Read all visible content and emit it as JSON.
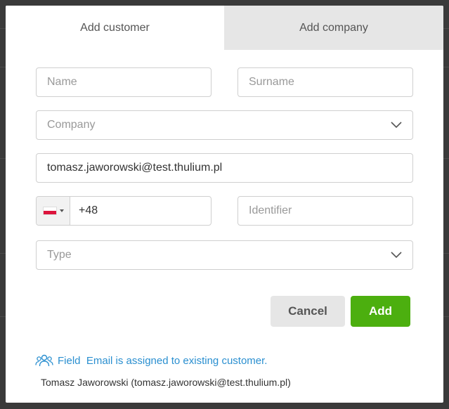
{
  "tabs": [
    {
      "label": "Add customer",
      "active": true
    },
    {
      "label": "Add company",
      "active": false
    }
  ],
  "form": {
    "name_placeholder": "Name",
    "surname_placeholder": "Surname",
    "company_placeholder": "Company",
    "email_value": "tomasz.jaworowski@test.thulium.pl",
    "phone_country_icon": "poland-flag-icon",
    "phone_value": "+48",
    "identifier_placeholder": "Identifier",
    "type_placeholder": "Type"
  },
  "buttons": {
    "cancel_label": "Cancel",
    "add_label": "Add"
  },
  "notice": {
    "icon": "users-icon",
    "text": "Field  Email is assigned to existing customer.",
    "existing_customer": "Tomasz Jaworowski (tomasz.jaworowski@test.thulium.pl)"
  },
  "colors": {
    "accent_green": "#4caf0f",
    "link_blue": "#2a8fd0",
    "inactive_tab": "#e6e6e6"
  }
}
